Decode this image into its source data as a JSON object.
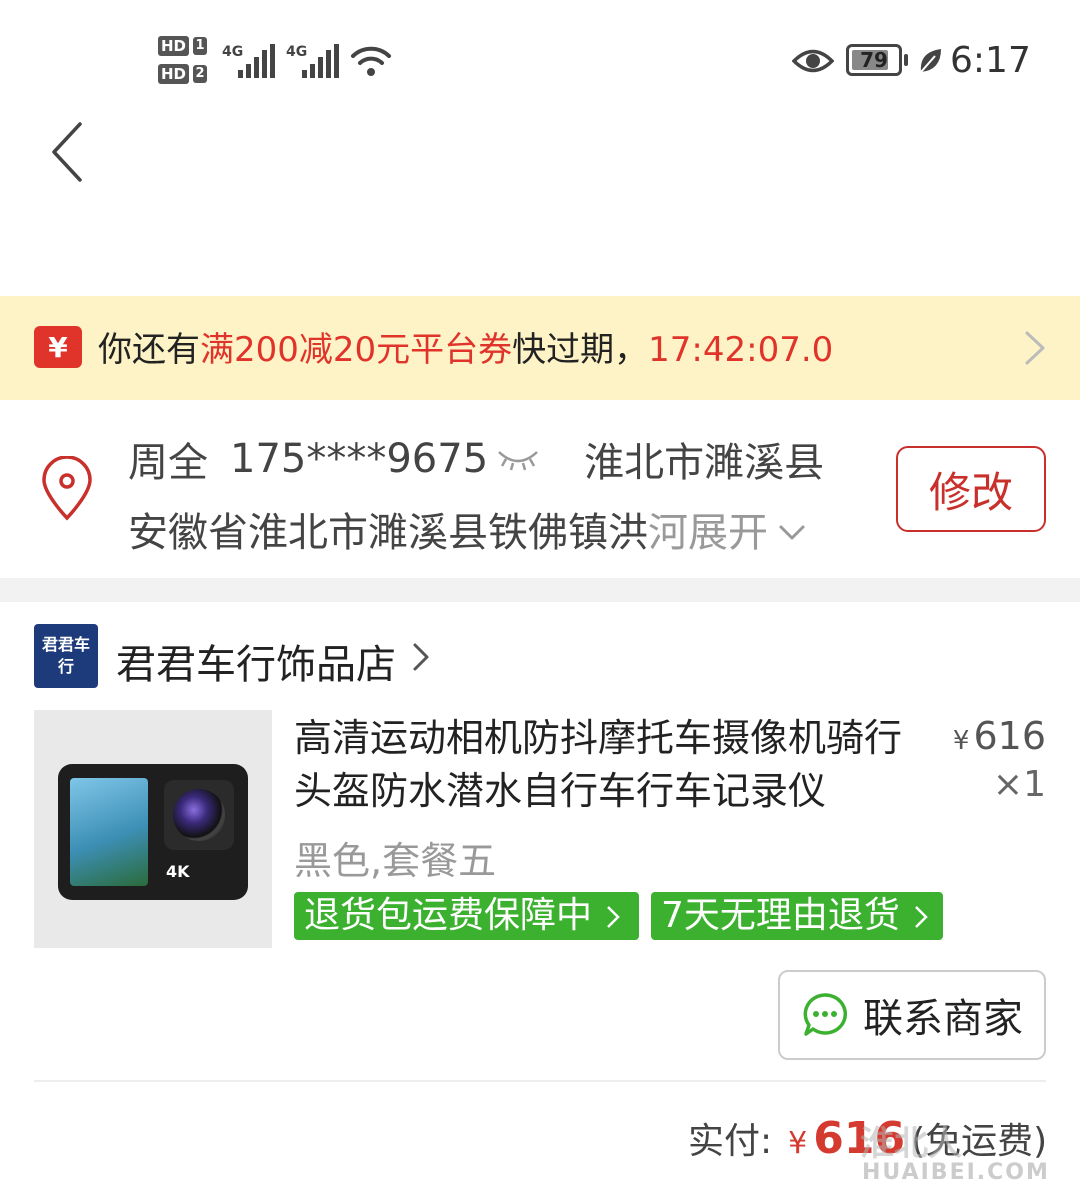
{
  "status_bar": {
    "sim1_label": "HD",
    "sim1_num": "1",
    "sim2_label": "HD",
    "sim2_num": "2",
    "signal1_tag": "4G",
    "signal2_tag": "4G",
    "battery_level": "79",
    "time": "6:17"
  },
  "coupon": {
    "icon_char": "¥",
    "prefix": "你还有",
    "highlight": "满200减20元平台券",
    "suffix": "快过期，",
    "countdown": "17:42:07.0"
  },
  "address": {
    "name": "周全",
    "phone": "175****9675",
    "region": "淮北市濉溪县",
    "detail": "安徽省淮北市濉溪县铁佛镇洪",
    "detail_faded": "河",
    "expand_label": "展开",
    "edit_label": "修改"
  },
  "store": {
    "logo_text": "君君车行",
    "name": "君君车行饰品店"
  },
  "product": {
    "title": "高清运动相机防抖摩托车摄像机骑行头盔防水潜水自行车行车记录仪",
    "price_symbol": "¥",
    "price": "616",
    "quantity": "×1",
    "variant": "黑色,套餐五",
    "badges": [
      "退货包运费保障中",
      "7天无理由退货"
    ],
    "image_label": "4K"
  },
  "actions": {
    "contact_label": "联系商家"
  },
  "total": {
    "label": "实付:",
    "symbol": "¥",
    "amount": "616",
    "note": "(免运费)"
  },
  "watermark": {
    "text": "淮北人",
    "sub": "HUAIBEI.COM"
  },
  "colors": {
    "accent_red": "#e0332a",
    "banner_bg": "#fdf3c7",
    "badge_green": "#3bb12f",
    "store_logo_bg": "#1d3a7a"
  }
}
